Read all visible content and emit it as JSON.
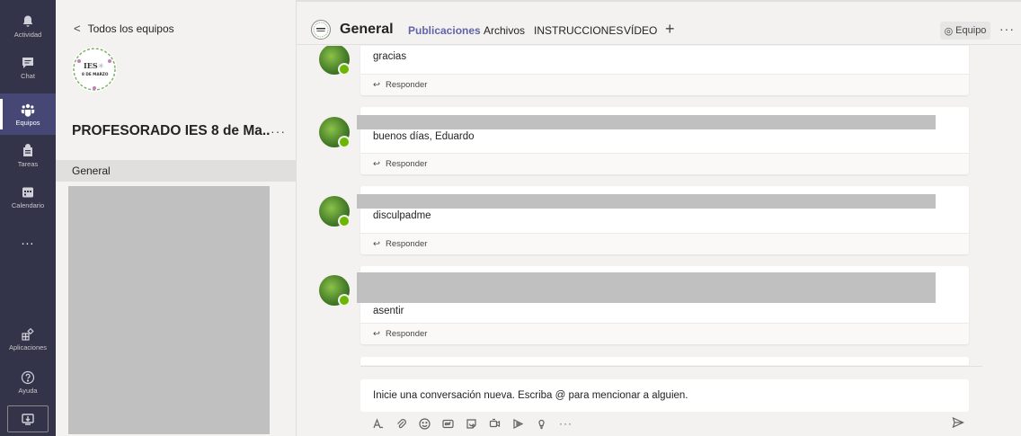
{
  "rail": {
    "items": [
      {
        "label": "Actividad",
        "icon": "bell-icon"
      },
      {
        "label": "Chat",
        "icon": "chat-icon"
      },
      {
        "label": "Equipos",
        "icon": "teams-icon"
      },
      {
        "label": "Tareas",
        "icon": "assignments-icon"
      },
      {
        "label": "Calendario",
        "icon": "calendar-icon"
      },
      {
        "label": "...",
        "icon": "more-icon"
      },
      {
        "label": "Aplicaciones",
        "icon": "apps-icon"
      },
      {
        "label": "Ayuda",
        "icon": "help-icon"
      }
    ],
    "active": "Equipos"
  },
  "team_panel": {
    "back_label": "Todos los equipos",
    "logo_text": "IES",
    "logo_subtext": "8 DE MARZO",
    "team_name": "PROFESORADO IES 8 de Ma...",
    "more": "···",
    "channel": "General"
  },
  "header": {
    "channel_title": "General",
    "tabs": [
      "Publicaciones",
      "Archivos",
      "INSTRUCCIONES",
      "VÍDEO"
    ],
    "active_tab": "Publicaciones",
    "add_tab": "+",
    "team_button": "Equipo",
    "more": "···"
  },
  "feed": {
    "posts": [
      {
        "text": "gracias",
        "reply": "Responder"
      },
      {
        "text": "buenos días, Eduardo",
        "reply": "Responder"
      },
      {
        "text": "disculpadme",
        "reply": "Responder"
      },
      {
        "text": "asentir",
        "reply": "Responder"
      }
    ]
  },
  "compose": {
    "placeholder": "Inicie una conversación nueva. Escriba @ para mencionar a alguien.",
    "tools": [
      "format-icon",
      "attach-icon",
      "emoji-icon",
      "gif-icon",
      "sticker-icon",
      "meet-icon",
      "stream-icon",
      "praise-icon"
    ],
    "more": "···"
  },
  "colors": {
    "rail_bg": "#33344a",
    "accent": "#6264a7",
    "presence": "#6bb700",
    "redacted": "#c0c0c0"
  }
}
